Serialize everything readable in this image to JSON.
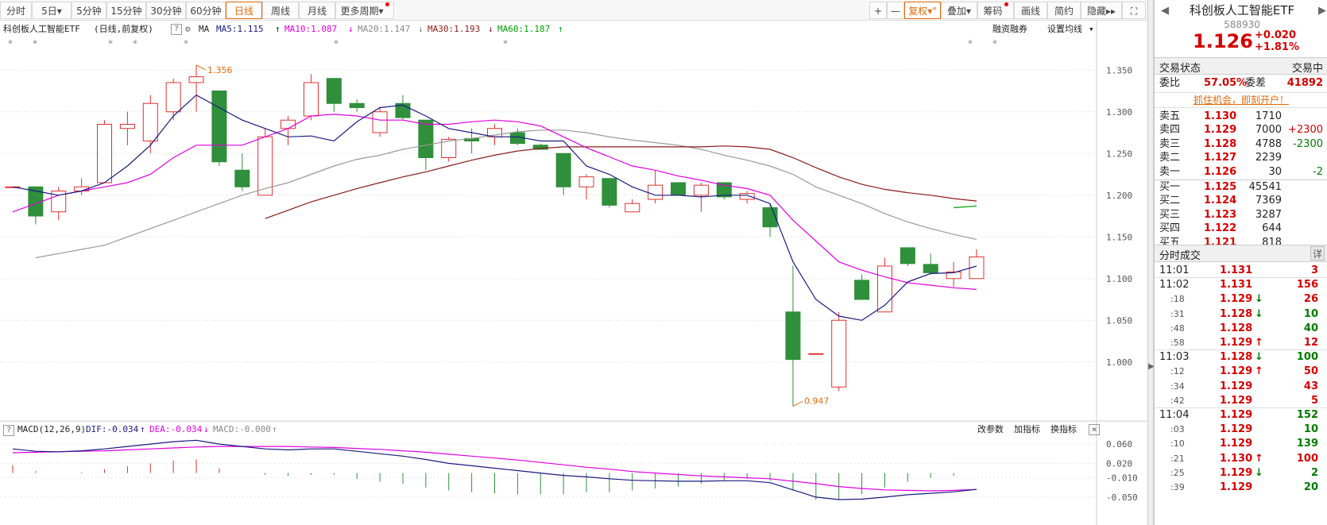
{
  "toolbar": {
    "periods": [
      "分时",
      "5日",
      "5分钟",
      "15分钟",
      "30分钟",
      "60分钟",
      "日线",
      "周线",
      "月线",
      "更多周期"
    ],
    "active": "日线",
    "right": [
      "+",
      "—",
      "复权",
      "叠加",
      "筹码",
      "画线",
      "简约",
      "隐藏"
    ]
  },
  "info": {
    "title": "科创板人工智能ETF",
    "subtitle": "(日线,前复权)",
    "ma_label": "MA",
    "ma5": "MA5:1.115",
    "ma10": "MA10:1.087",
    "ma20": "MA20:1.147",
    "ma30": "MA30:1.193",
    "ma60": "MA60:1.187",
    "rzrq": "融资融券",
    "setma": "设置均线"
  },
  "macd": {
    "label": "MACD(12,26,9)",
    "dif": "DIF:-0.034",
    "dea": "DEA:-0.034",
    "macd": "MACD:-0.000",
    "btn_params": "改参数",
    "btn_add": "加指标",
    "btn_switch": "换指标"
  },
  "colors": {
    "up": "#e03030",
    "down": "#2f8f3a",
    "ma5": "#1a1a80",
    "ma10": "#e000e0",
    "ma20": "#999999",
    "ma30": "#8b1a1a",
    "ma60": "#00a000",
    "accent": "#e36a0a"
  },
  "chart_data": {
    "type": "candlestick",
    "y_ticks": [
      "1.350",
      "1.300",
      "1.250",
      "1.200",
      "1.150",
      "1.100",
      "1.050",
      "1.000"
    ],
    "ylim": [
      0.935,
      1.375
    ],
    "high_label": "1.356",
    "low_label": "0.947",
    "candles": [
      [
        1.21,
        1.21,
        1.21,
        1.21
      ],
      [
        1.21,
        1.2,
        1.165,
        1.175
      ],
      [
        1.18,
        1.21,
        1.17,
        1.205
      ],
      [
        1.205,
        1.22,
        1.2,
        1.21
      ],
      [
        1.215,
        1.29,
        1.215,
        1.285
      ],
      [
        1.28,
        1.3,
        1.26,
        1.285
      ],
      [
        1.265,
        1.32,
        1.25,
        1.31
      ],
      [
        1.3,
        1.34,
        1.29,
        1.335
      ],
      [
        1.335,
        1.356,
        1.3,
        1.342
      ],
      [
        1.325,
        1.325,
        1.235,
        1.24
      ],
      [
        1.23,
        1.25,
        1.205,
        1.21
      ],
      [
        1.2,
        1.28,
        1.2,
        1.27
      ],
      [
        1.28,
        1.295,
        1.26,
        1.29
      ],
      [
        1.295,
        1.345,
        1.29,
        1.335
      ],
      [
        1.34,
        1.34,
        1.3,
        1.31
      ],
      [
        1.31,
        1.315,
        1.3,
        1.305
      ],
      [
        1.275,
        1.305,
        1.27,
        1.3
      ],
      [
        1.31,
        1.32,
        1.29,
        1.293
      ],
      [
        1.29,
        1.29,
        1.23,
        1.245
      ],
      [
        1.245,
        1.27,
        1.24,
        1.267
      ],
      [
        1.268,
        1.28,
        1.25,
        1.265
      ],
      [
        1.27,
        1.285,
        1.26,
        1.28
      ],
      [
        1.275,
        1.28,
        1.26,
        1.262
      ],
      [
        1.26,
        1.262,
        1.255,
        1.255
      ],
      [
        1.25,
        1.25,
        1.2,
        1.21
      ],
      [
        1.21,
        1.225,
        1.195,
        1.222
      ],
      [
        1.22,
        1.22,
        1.185,
        1.188
      ],
      [
        1.18,
        1.195,
        1.18,
        1.19
      ],
      [
        1.195,
        1.23,
        1.19,
        1.212
      ],
      [
        1.215,
        1.215,
        1.2,
        1.2
      ],
      [
        1.2,
        1.215,
        1.18,
        1.212
      ],
      [
        1.215,
        1.215,
        1.195,
        1.198
      ],
      [
        1.195,
        1.205,
        1.19,
        1.202
      ],
      [
        1.185,
        1.19,
        1.15,
        1.162
      ],
      [
        1.06,
        1.115,
        0.947,
        1.003
      ],
      [
        1.01,
        1.01,
        1.01,
        1.01
      ],
      [
        0.97,
        1.06,
        0.965,
        1.05
      ],
      [
        1.098,
        1.105,
        1.075,
        1.075
      ],
      [
        1.06,
        1.125,
        1.06,
        1.115
      ],
      [
        1.137,
        1.137,
        1.115,
        1.118
      ],
      [
        1.117,
        1.13,
        1.105,
        1.107
      ],
      [
        1.1,
        1.12,
        1.09,
        1.108
      ],
      [
        1.1,
        1.135,
        1.1,
        1.126
      ]
    ],
    "ma5": [
      1.21,
      1.205,
      1.2,
      1.205,
      1.215,
      1.235,
      1.26,
      1.295,
      1.32,
      1.305,
      1.29,
      1.28,
      1.27,
      1.271,
      1.265,
      1.288,
      1.305,
      1.308,
      1.295,
      1.28,
      1.275,
      1.27,
      1.27,
      1.265,
      1.265,
      1.235,
      1.225,
      1.21,
      1.2,
      1.2,
      1.198,
      1.2,
      1.2,
      1.19,
      1.12,
      1.075,
      1.055,
      1.05,
      1.068,
      1.096,
      1.106,
      1.107,
      1.115
    ],
    "ma10": [
      1.18,
      1.19,
      1.2,
      1.205,
      1.21,
      1.215,
      1.225,
      1.245,
      1.26,
      1.26,
      1.26,
      1.27,
      1.28,
      1.295,
      1.297,
      1.295,
      1.29,
      1.29,
      1.285,
      1.285,
      1.288,
      1.29,
      1.288,
      1.283,
      1.27,
      1.257,
      1.246,
      1.235,
      1.23,
      1.223,
      1.218,
      1.212,
      1.208,
      1.2,
      1.17,
      1.145,
      1.12,
      1.11,
      1.102,
      1.095,
      1.092,
      1.089,
      1.087
    ],
    "ma20": [
      null,
      1.125,
      1.13,
      1.135,
      1.14,
      1.15,
      1.16,
      1.17,
      1.18,
      1.19,
      1.2,
      1.208,
      1.215,
      1.225,
      1.235,
      1.243,
      1.248,
      1.255,
      1.26,
      1.265,
      1.268,
      1.272,
      1.276,
      1.278,
      1.278,
      1.275,
      1.27,
      1.266,
      1.263,
      1.26,
      1.255,
      1.248,
      1.242,
      1.235,
      1.225,
      1.21,
      1.2,
      1.19,
      1.178,
      1.168,
      1.16,
      1.153,
      1.147
    ],
    "ma30": [
      null,
      null,
      null,
      null,
      null,
      null,
      null,
      null,
      null,
      null,
      null,
      1.172,
      1.182,
      1.192,
      1.2,
      1.208,
      1.215,
      1.222,
      1.228,
      1.235,
      1.242,
      1.248,
      1.253,
      1.256,
      1.258,
      1.258,
      1.258,
      1.258,
      1.258,
      1.258,
      1.258,
      1.259,
      1.258,
      1.255,
      1.245,
      1.233,
      1.222,
      1.213,
      1.207,
      1.203,
      1.2,
      1.196,
      1.193
    ],
    "ma60": [
      null,
      null,
      null,
      null,
      null,
      null,
      null,
      null,
      null,
      null,
      null,
      null,
      null,
      null,
      null,
      null,
      null,
      null,
      null,
      null,
      null,
      null,
      null,
      null,
      null,
      null,
      null,
      null,
      null,
      null,
      null,
      null,
      null,
      null,
      null,
      null,
      null,
      null,
      null,
      null,
      null,
      1.185,
      1.187
    ],
    "macd_ticks": [
      "0.060",
      "0.020",
      "-0.010",
      "-0.050"
    ],
    "macd_ylim": [
      -0.06,
      0.075
    ],
    "dif": [
      0.05,
      0.045,
      0.044,
      0.046,
      0.05,
      0.055,
      0.06,
      0.065,
      0.068,
      0.06,
      0.055,
      0.05,
      0.048,
      0.05,
      0.05,
      0.045,
      0.04,
      0.035,
      0.028,
      0.02,
      0.015,
      0.01,
      0.005,
      0.0,
      -0.005,
      -0.008,
      -0.012,
      -0.015,
      -0.016,
      -0.017,
      -0.017,
      -0.016,
      -0.016,
      -0.02,
      -0.035,
      -0.05,
      -0.055,
      -0.054,
      -0.05,
      -0.045,
      -0.042,
      -0.039,
      -0.034
    ],
    "dea": [
      0.042,
      0.043,
      0.044,
      0.045,
      0.046,
      0.048,
      0.05,
      0.052,
      0.054,
      0.055,
      0.055,
      0.055,
      0.055,
      0.054,
      0.053,
      0.051,
      0.049,
      0.046,
      0.043,
      0.039,
      0.035,
      0.031,
      0.027,
      0.022,
      0.017,
      0.012,
      0.008,
      0.003,
      0.0,
      -0.003,
      -0.006,
      -0.008,
      -0.01,
      -0.012,
      -0.017,
      -0.022,
      -0.028,
      -0.032,
      -0.035,
      -0.036,
      -0.037,
      -0.036,
      -0.034
    ],
    "macd_hist": [
      0.016,
      0.004,
      0.0,
      0.002,
      0.008,
      0.014,
      0.02,
      0.026,
      0.028,
      0.01,
      0.0,
      -0.004,
      -0.006,
      -0.004,
      -0.004,
      -0.012,
      -0.018,
      -0.022,
      -0.03,
      -0.036,
      -0.04,
      -0.042,
      -0.044,
      -0.044,
      -0.044,
      -0.04,
      -0.04,
      -0.036,
      -0.032,
      -0.028,
      -0.022,
      -0.016,
      -0.012,
      -0.016,
      -0.036,
      -0.056,
      -0.054,
      -0.044,
      -0.03,
      -0.018,
      -0.01,
      -0.006,
      -0.0
    ]
  },
  "quote": {
    "name": "科创板人工智能ETF",
    "code": "588930",
    "price": "1.126",
    "change": "+0.020",
    "pct": "+1.81%",
    "status_label": "交易状态",
    "status_value": "交易中",
    "weibi_label": "委比",
    "weibi_value": "57.05%",
    "weicha_label": "委差",
    "weicha_value": "41892",
    "ad": "抓住机会，即刻开户！"
  },
  "orderbook": [
    {
      "label": "卖五",
      "price": "1.130",
      "vol": "1710",
      "chg": ""
    },
    {
      "label": "卖四",
      "price": "1.129",
      "vol": "7000",
      "chg": "+2300"
    },
    {
      "label": "卖三",
      "price": "1.128",
      "vol": "4788",
      "chg": "-2300"
    },
    {
      "label": "卖二",
      "price": "1.127",
      "vol": "2239",
      "chg": ""
    },
    {
      "label": "卖一",
      "price": "1.126",
      "vol": "30",
      "chg": "-2"
    },
    {
      "label": "买一",
      "price": "1.125",
      "vol": "45541",
      "chg": ""
    },
    {
      "label": "买二",
      "price": "1.124",
      "vol": "7369",
      "chg": ""
    },
    {
      "label": "买三",
      "price": "1.123",
      "vol": "3287",
      "chg": ""
    },
    {
      "label": "买四",
      "price": "1.122",
      "vol": "644",
      "chg": ""
    },
    {
      "label": "买五",
      "price": "1.121",
      "vol": "818",
      "chg": ""
    }
  ],
  "ticks_header": "分时成交",
  "ticks_detail": "详",
  "ticks": [
    {
      "time": "11:01",
      "price": "1.131",
      "arrow": "",
      "vol": "3",
      "vcolor": "red"
    },
    {
      "time": "11:02",
      "price": "1.131",
      "arrow": "",
      "vol": "156",
      "vcolor": "red"
    },
    {
      "time": ":18",
      "price": "1.129",
      "arrow": "↓",
      "vol": "26",
      "vcolor": "red"
    },
    {
      "time": ":31",
      "price": "1.128",
      "arrow": "↓",
      "vol": "10",
      "vcolor": "green"
    },
    {
      "time": ":48",
      "price": "1.128",
      "arrow": "",
      "vol": "40",
      "vcolor": "green"
    },
    {
      "time": ":58",
      "price": "1.129",
      "arrow": "↑",
      "vol": "12",
      "vcolor": "red"
    },
    {
      "time": "11:03",
      "price": "1.128",
      "arrow": "↓",
      "vol": "100",
      "vcolor": "green"
    },
    {
      "time": ":12",
      "price": "1.129",
      "arrow": "↑",
      "vol": "50",
      "vcolor": "red"
    },
    {
      "time": ":34",
      "price": "1.129",
      "arrow": "",
      "vol": "43",
      "vcolor": "red"
    },
    {
      "time": ":42",
      "price": "1.129",
      "arrow": "",
      "vol": "5",
      "vcolor": "red"
    },
    {
      "time": "11:04",
      "price": "1.129",
      "arrow": "",
      "vol": "152",
      "vcolor": "green"
    },
    {
      "time": ":03",
      "price": "1.129",
      "arrow": "",
      "vol": "10",
      "vcolor": "green"
    },
    {
      "time": ":10",
      "price": "1.129",
      "arrow": "",
      "vol": "139",
      "vcolor": "green"
    },
    {
      "time": ":21",
      "price": "1.130",
      "arrow": "↑",
      "vol": "100",
      "vcolor": "red"
    },
    {
      "time": ":25",
      "price": "1.129",
      "arrow": "↓",
      "vol": "2",
      "vcolor": "green"
    },
    {
      "time": ":39",
      "price": "1.129",
      "arrow": "",
      "vol": "20",
      "vcolor": "green"
    }
  ]
}
